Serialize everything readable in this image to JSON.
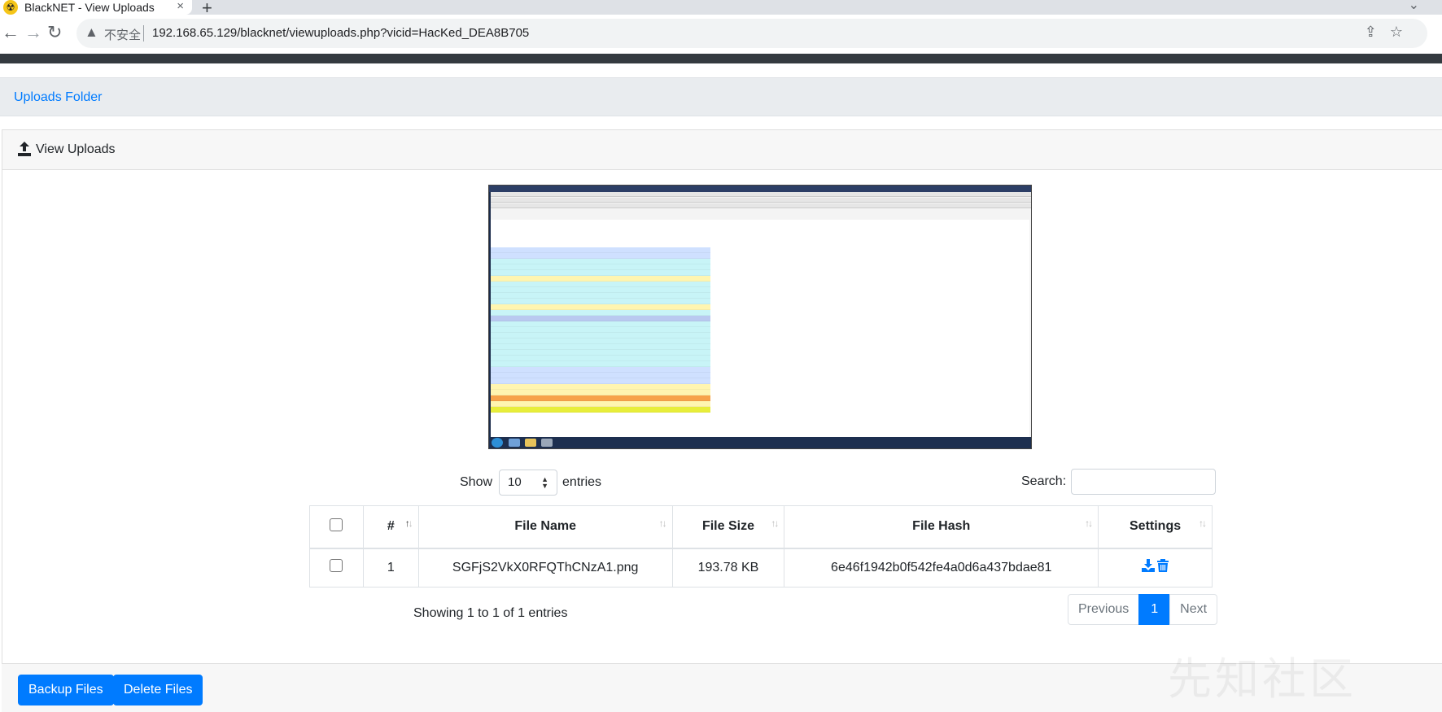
{
  "browser": {
    "tab_title": "BlackNET - View Uploads",
    "tab_close": "×",
    "new_tab": "+",
    "insecure_label": "不安全",
    "url": "192.168.65.129/blacknet/viewuploads.php?vicid=HacKed_DEA8B705"
  },
  "breadcrumb": {
    "label": "Uploads Folder"
  },
  "card": {
    "title": "View Uploads"
  },
  "controls": {
    "show_label": "Show",
    "page_size": "10",
    "entries_label": "entries",
    "search_label": "Search:"
  },
  "table": {
    "headers": [
      "#",
      "File Name",
      "File Size",
      "File Hash",
      "Settings"
    ],
    "rows": [
      {
        "index": "1",
        "file_name": "SGFjS2VkX0RFQThCNzA1.png",
        "file_size": "193.78 KB",
        "file_hash": "6e46f1942b0f542fe4a0d6a437bdae81"
      }
    ]
  },
  "pagination": {
    "info": "Showing 1 to 1 of 1 entries",
    "previous": "Previous",
    "current": "1",
    "next": "Next"
  },
  "footer": {
    "backup_label": "Backup Files",
    "delete_label": "Delete Files"
  },
  "watermark": "先知社区",
  "colors": {
    "primary": "#007bff",
    "navbar": "#343a40",
    "breadcrumb_bg": "#e9ecef"
  }
}
